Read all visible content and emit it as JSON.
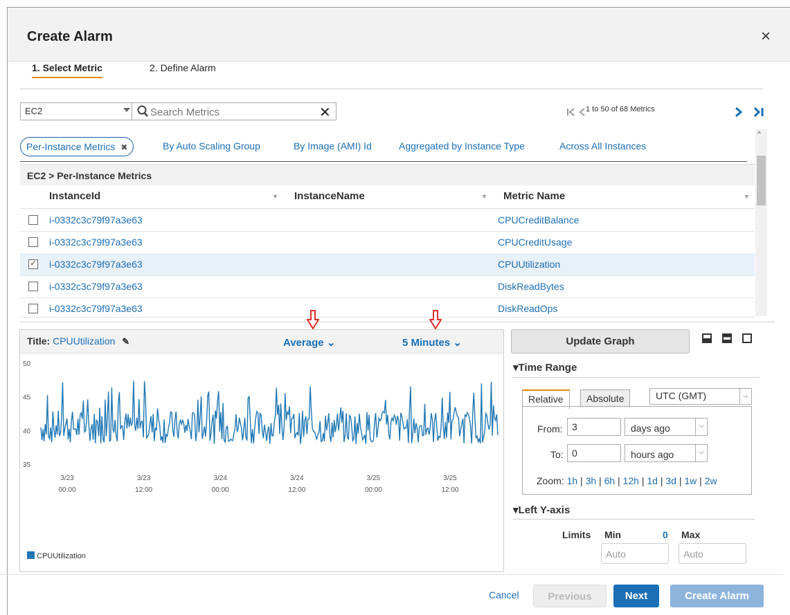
{
  "dialog": {
    "title": "Create Alarm",
    "close_label": "×"
  },
  "steps": [
    {
      "label": "1. Select Metric"
    },
    {
      "label": "2. Define Alarm"
    }
  ],
  "toolbar": {
    "namespace_value": "EC2",
    "search_placeholder": "Search Metrics",
    "search_clear": "✕",
    "pager_text": "1 to 50 of 68 Metrics",
    "first_icon": "|<",
    "prev_icon": "<",
    "next_icon": ">",
    "last_icon": ">|"
  },
  "subtabs": {
    "active": {
      "label": "Per-Instance Metrics",
      "remove": "✖"
    },
    "items": [
      "By Auto Scaling Group",
      "By Image (AMI) Id",
      "Aggregated by Instance Type",
      "Across All Instances"
    ]
  },
  "breadcrumb": "EC2 > Per-Instance Metrics",
  "table": {
    "columns": [
      "InstanceId",
      "InstanceName",
      "Metric Name"
    ],
    "rows": [
      {
        "instance_id": "i-0332c3c79f97a3e63",
        "instance_name": "",
        "metric": "CPUCreditBalance",
        "checked": false
      },
      {
        "instance_id": "i-0332c3c79f97a3e63",
        "instance_name": "",
        "metric": "CPUCreditUsage",
        "checked": false
      },
      {
        "instance_id": "i-0332c3c79f97a3e63",
        "instance_name": "",
        "metric": "CPUUtilization",
        "checked": true
      },
      {
        "instance_id": "i-0332c3c79f97a3e63",
        "instance_name": "",
        "metric": "DiskReadBytes",
        "checked": false
      },
      {
        "instance_id": "i-0332c3c79f97a3e63",
        "instance_name": "",
        "metric": "DiskReadOps",
        "checked": false
      }
    ]
  },
  "graph": {
    "title_label": "Title:",
    "title_value": "CPUUtilization",
    "statistic": "Average",
    "period": "5 Minutes",
    "legend": "CPUUtilization",
    "series_color": "#1f77b4"
  },
  "chart_data": {
    "type": "line",
    "y_ticks": [
      "50",
      "45",
      "40",
      "35"
    ],
    "ylim": [
      35,
      50
    ],
    "x_ticks": [
      {
        "date": "3/23",
        "time": "00:00"
      },
      {
        "date": "3/23",
        "time": "12:00"
      },
      {
        "date": "3/24",
        "time": "00:00"
      },
      {
        "date": "3/24",
        "time": "12:00"
      },
      {
        "date": "3/25",
        "time": "00:00"
      },
      {
        "date": "3/25",
        "time": "12:00"
      }
    ],
    "series": [
      {
        "name": "CPUUtilization",
        "typical_range": [
          38,
          43
        ],
        "peak_max": 47.5
      }
    ]
  },
  "side": {
    "update_label": "Update Graph",
    "time_range_label": "Time Range",
    "tab_relative": "Relative",
    "tab_absolute": "Absolute",
    "timezone": "UTC (GMT)",
    "from_label": "From:",
    "from_value": "3",
    "from_unit": "days ago",
    "to_label": "To:",
    "to_value": "0",
    "to_unit": "hours ago",
    "zoom_label": "Zoom:",
    "zoom_options": [
      "1h",
      "3h",
      "6h",
      "12h",
      "1d",
      "3d",
      "1w",
      "2w"
    ],
    "left_axis_label": "Left Y-axis",
    "limits_label": "Limits",
    "min_label": "Min",
    "min_value": "0",
    "max_label": "Max",
    "min_placeholder": "Auto",
    "max_placeholder": "Auto"
  },
  "footer": {
    "cancel": "Cancel",
    "previous": "Previous",
    "next": "Next",
    "create": "Create Alarm"
  },
  "colors": {
    "link": "#1a6fb5",
    "accent": "#e68a00",
    "primary": "#1a6fb5",
    "annotation": "#d9302c"
  }
}
